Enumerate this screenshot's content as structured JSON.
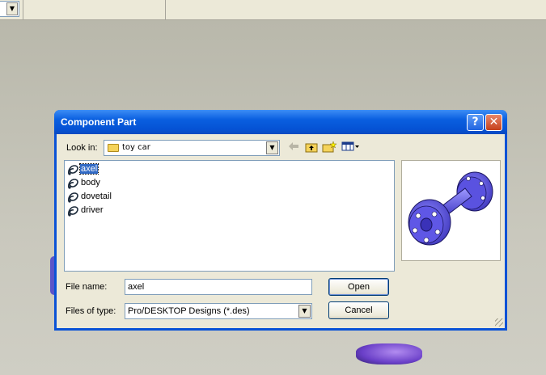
{
  "dialog": {
    "title": "Component Part",
    "help_glyph": "?",
    "close_glyph": "✕",
    "look_in_label": "Look in:",
    "look_in_value": "toy car",
    "files": [
      {
        "name": "axel",
        "selected": true
      },
      {
        "name": "body",
        "selected": false
      },
      {
        "name": "dovetail",
        "selected": false
      },
      {
        "name": "driver",
        "selected": false
      }
    ],
    "file_name_label": "File name:",
    "file_name_value": "axel",
    "files_of_type_label": "Files of type:",
    "files_of_type_value": "Pro/DESKTOP Designs (*.des)",
    "open_label": "Open",
    "cancel_label": "Cancel"
  },
  "icons": {
    "back": "back-arrow-icon",
    "up": "up-folder-icon",
    "new_folder": "new-folder-icon",
    "view": "view-menu-icon",
    "file": "design-file-icon"
  },
  "colors": {
    "titlebar": "#0a5fe0",
    "selection": "#316ac5",
    "preview_part": "#5f57e6"
  }
}
